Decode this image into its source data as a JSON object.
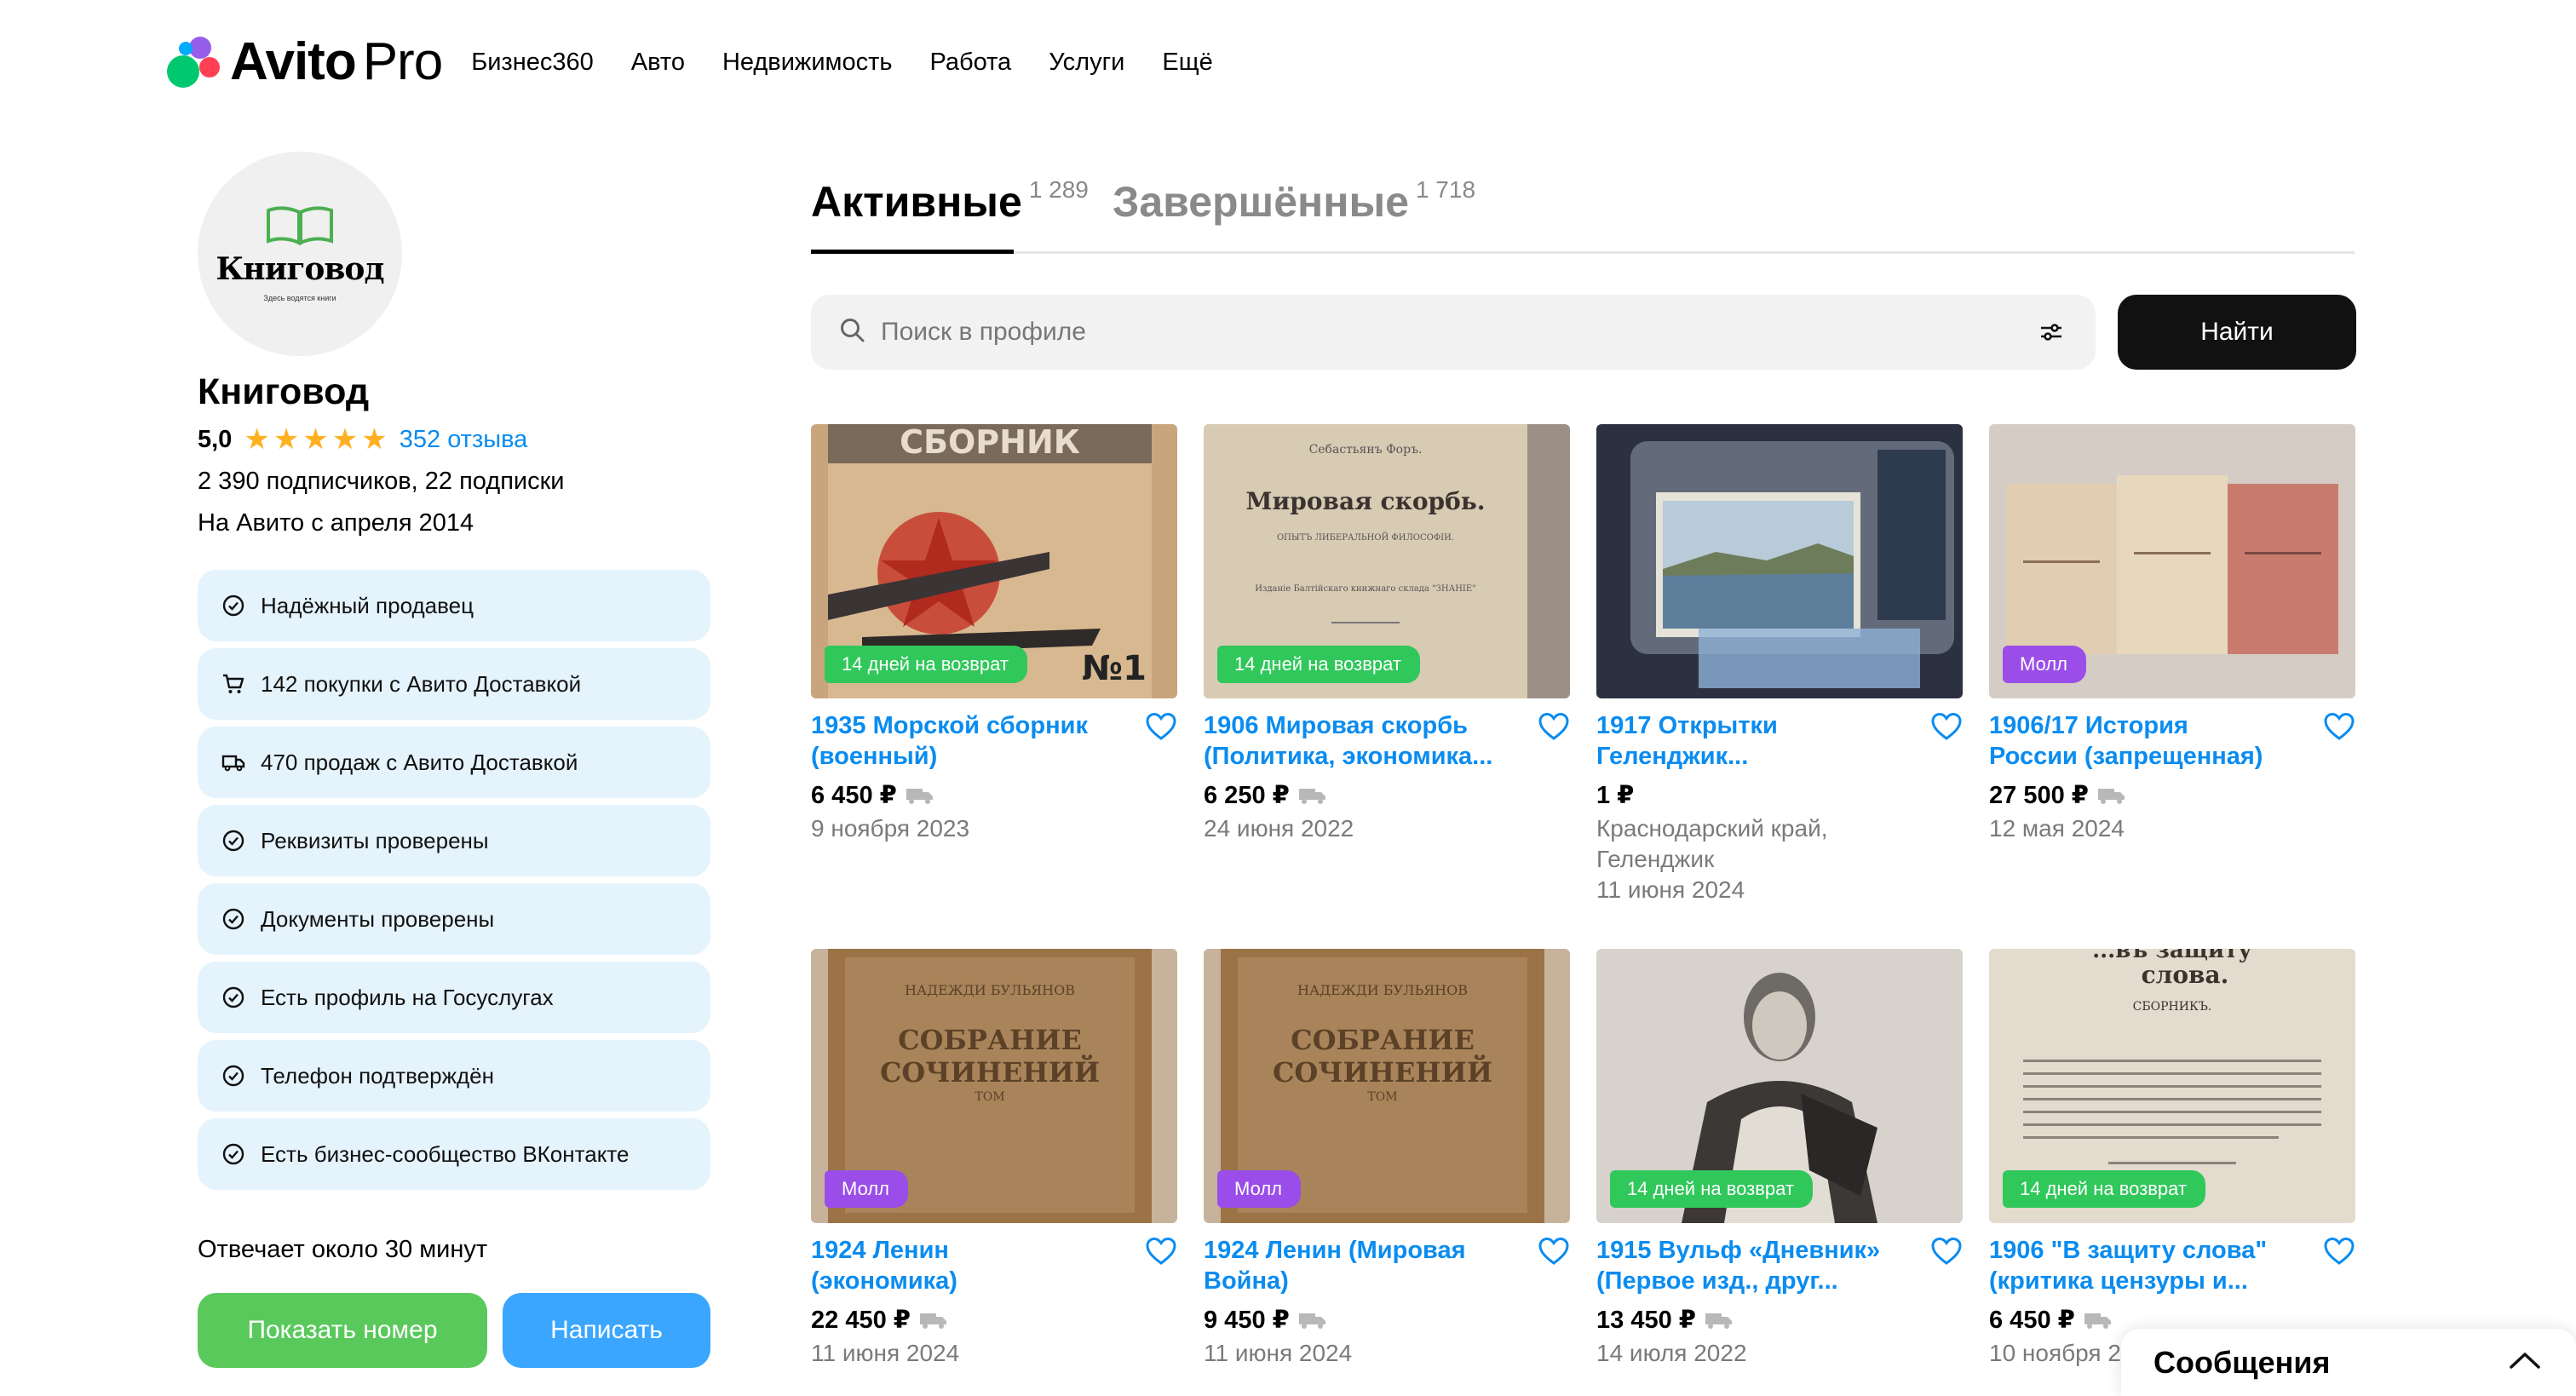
{
  "header": {
    "logo_main": "Avito",
    "logo_pro": "Pro",
    "nav": [
      "Бизнес360",
      "Авто",
      "Недвижимость",
      "Работа",
      "Услуги",
      "Ещё"
    ]
  },
  "profile": {
    "avatar_name": "Книговод",
    "avatar_tagline": "Здесь водятся книги",
    "name": "Книговод",
    "rating": "5,0",
    "stars": 5,
    "reviews": "352 отзыва",
    "followers": "2 390 подписчиков, 22 подписки",
    "since": "На Авито с апреля 2014",
    "badges": [
      {
        "icon": "check-circle-icon",
        "label": "Надёжный продавец"
      },
      {
        "icon": "cart-icon",
        "label": "142 покупки с Авито Доставкой"
      },
      {
        "icon": "truck-icon",
        "label": "470 продаж с Авито Доставкой"
      },
      {
        "icon": "check-circle-icon",
        "label": "Реквизиты проверены"
      },
      {
        "icon": "check-circle-icon",
        "label": "Документы проверены"
      },
      {
        "icon": "check-circle-icon",
        "label": "Есть профиль на Госуслугах"
      },
      {
        "icon": "check-circle-icon",
        "label": "Телефон подтверждён"
      },
      {
        "icon": "check-circle-icon",
        "label": "Есть бизнес-сообщество ВКонтакте"
      }
    ],
    "reply_time": "Отвечает около 30 минут",
    "show_phone": "Показать номер",
    "write": "Написать"
  },
  "tabs": {
    "active_label": "Активные",
    "active_count": "1 289",
    "done_label": "Завершённые",
    "done_count": "1 718"
  },
  "search": {
    "placeholder": "Поиск в профиле",
    "button": "Найти"
  },
  "listings": [
    {
      "title_1": "1935 Морской сборник",
      "title_2": "(военный)",
      "price": "6 450 ₽",
      "meta": [
        "9 ноября 2023"
      ],
      "tag": "14 дней на возврат",
      "tag_color": "#30c75b"
    },
    {
      "title_1": "1906 Мировая скорбь",
      "title_2": "(Политика, экономика...",
      "price": "6 250 ₽",
      "meta": [
        "24 июня 2022"
      ],
      "tag": "14 дней на возврат",
      "tag_color": "#30c75b"
    },
    {
      "title_1": "1917 Открытки",
      "title_2": "Геленджик...",
      "price": "1 ₽",
      "meta": [
        "Краснодарский край,",
        "Геленджик",
        "11 июня 2024"
      ],
      "tag": "",
      "tag_color": ""
    },
    {
      "title_1": "1906/17 История",
      "title_2": "России (запрещенная)",
      "price": "27 500 ₽",
      "meta": [
        "12 мая 2024"
      ],
      "tag": "Молл",
      "tag_color": "#9a4de8"
    },
    {
      "title_1": "1924 Ленин",
      "title_2": "(экономика)",
      "price": "22 450 ₽",
      "meta": [
        "11 июня 2024"
      ],
      "tag": "Молл",
      "tag_color": "#9a4de8"
    },
    {
      "title_1": "1924 Ленин (Мировая",
      "title_2": "Война)",
      "price": "9 450 ₽",
      "meta": [
        "11 июня 2024"
      ],
      "tag": "Молл",
      "tag_color": "#9a4de8"
    },
    {
      "title_1": "1915 Вульф «Дневник»",
      "title_2": "(Первое изд., друг...",
      "price": "13 450 ₽",
      "meta": [
        "14 июля 2022"
      ],
      "tag": "14 дней на возврат",
      "tag_color": "#30c75b"
    },
    {
      "title_1": "1906 \"В защиту слова\"",
      "title_2": "(критика цензуры и...",
      "price": "6 450 ₽",
      "meta": [
        "10 ноября 2"
      ],
      "tag": "14 дней на возврат",
      "tag_color": "#30c75b"
    }
  ],
  "image_texts": {
    "sbornik": "СБОРНИК",
    "no1": "№1",
    "skorb_author": "Себастьянъ Форъ.",
    "skorb_title": "Мировая скорбь.",
    "skorb_sub": "ОПЫТЪ ЛИБЕРАЛЬНОЙ ФИЛОСОФІИ.",
    "skorb_pub": "Изданіе Балтійскаго книжнаго склада \"ЗНАНІЕ\"",
    "lenin_author": "НАДЕЖДИ БУЛЬЯНОВ",
    "lenin_title_1": "СОБРАНИЕ",
    "lenin_title_2": "СОЧИНЕНИЙ",
    "lenin_tom": "ТОМ",
    "zashchitu_1": "...въ защиту",
    "zashchitu_2": "слова.",
    "zashchitu_3": "СБОРНИКЪ."
  },
  "messages": {
    "title": "Сообщения"
  }
}
